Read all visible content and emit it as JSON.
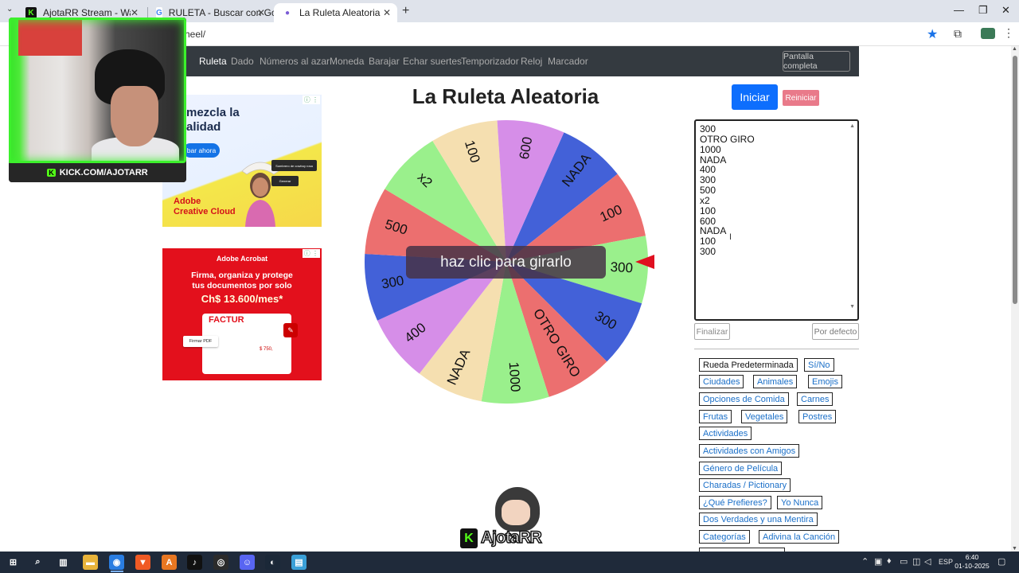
{
  "browser": {
    "tabs": [
      {
        "title": "AjotaRR Stream - Watch Live o",
        "fav": "K",
        "fav_color": "#111111",
        "fav_text": "#53fc18"
      },
      {
        "title": "RULETA - Buscar con Google",
        "fav": "G",
        "fav_color": "#ffffff",
        "fav_text": "#4285f4"
      },
      {
        "title": "La Ruleta Aleatoria",
        "fav": "●",
        "fav_color": "#ffffff",
        "fav_text": "#7b5cd6"
      }
    ],
    "url": "heel/",
    "newtab": "+",
    "controls": {
      "minimize": "—",
      "restore": "❐",
      "close": "✕"
    }
  },
  "nav": {
    "items": [
      "Ruleta",
      "Dado",
      "Números al azar",
      "Moneda",
      "Barajar",
      "Echar suertes",
      "Temporizador",
      "Reloj",
      "Marcador"
    ],
    "fullscreen": "Pantalla completa"
  },
  "page": {
    "title": "La Ruleta Aleatoria",
    "start": "Iniciar",
    "reset": "Reiniciar",
    "spin_prompt": "haz clic para girarlo",
    "finish": "Finalizar",
    "default": "Por defecto"
  },
  "entries": [
    "300",
    "OTRO GIRO",
    "1000",
    "NADA",
    "400",
    "300",
    "500",
    "x2",
    "100",
    "600",
    "NADA",
    "100",
    "300"
  ],
  "presets": [
    "Rueda Predeterminada",
    "Sí/No",
    "Ciudades",
    "Animales",
    "Emojis",
    "Opciones de Comida",
    "Carnes",
    "Frutas",
    "Vegetales",
    "Postres",
    "Actividades",
    "Actividades con Amigos",
    "Género de Película",
    "Charadas / Pictionary",
    "¿Qué Prefieres?",
    "Yo Nunca",
    "Dos Verdades y una Mentira",
    "Categorías",
    "Adivina la Canción"
  ],
  "wheel": {
    "segments": [
      {
        "label": "NADA",
        "color": "#4361d8"
      },
      {
        "label": "100",
        "color": "#ec6f6f"
      },
      {
        "label": "300",
        "color": "#9af08c"
      },
      {
        "label": "300",
        "color": "#4361d8"
      },
      {
        "label": "OTRO GIRO",
        "color": "#ec6f6f"
      },
      {
        "label": "1000",
        "color": "#9af08c"
      },
      {
        "label": "NADA",
        "color": "#f5dfb0"
      },
      {
        "label": "400",
        "color": "#d68ee8"
      },
      {
        "label": "300",
        "color": "#4361d8"
      },
      {
        "label": "500",
        "color": "#ec6f6f"
      },
      {
        "label": "x2",
        "color": "#9af08c"
      },
      {
        "label": "100",
        "color": "#f5dfb0"
      },
      {
        "label": "600",
        "color": "#d68ee8"
      }
    ],
    "pointer_color": "#e01020"
  },
  "ads": {
    "ad1": {
      "headline_1": "mezcla la",
      "headline_2": "alidad",
      "cta": "bar ahora",
      "brand_1": "Adobe",
      "brand_2": "Creative Cloud",
      "card_1": "Sombrero de cowboy rosa",
      "card_2": "Generar",
      "choice": "ⓘ ⋮"
    },
    "ad2": {
      "brand": "Adobe Acrobat",
      "line_1": "Firma, organiza y protege",
      "line_2": "tus documentos por solo",
      "price": "Ch$ 13.600/mes*",
      "doc_title": "FACTUR",
      "sign": "Firmar PDF",
      "amount": "$ 750,",
      "choice": "ⓘ ⋮"
    }
  },
  "webcam": {
    "kick_label": "KICK.COM/AJOTARR",
    "kick_badge": "K"
  },
  "streamer_logo": {
    "name": "AjotaRR",
    "badge": "K"
  },
  "taskbar": {
    "apps": [
      {
        "name": "windows",
        "color": "#1f2a3a",
        "glyph": "⊞"
      },
      {
        "name": "search",
        "color": "#1f2a3a",
        "glyph": "⌕"
      },
      {
        "name": "taskview",
        "color": "#1f2a3a",
        "glyph": "▥"
      },
      {
        "name": "explorer",
        "color": "#e8b33a",
        "glyph": "▬"
      },
      {
        "name": "chrome",
        "color": "#2a7de1",
        "glyph": "◉"
      },
      {
        "name": "brave",
        "color": "#f05a24",
        "glyph": "▼"
      },
      {
        "name": "app-a",
        "color": "#e87722",
        "glyph": "A"
      },
      {
        "name": "tiktok",
        "color": "#111111",
        "glyph": "♪"
      },
      {
        "name": "obs",
        "color": "#2b2b2b",
        "glyph": "◎"
      },
      {
        "name": "discord",
        "color": "#5865f2",
        "glyph": "☺"
      },
      {
        "name": "steam",
        "color": "#1b2838",
        "glyph": "◐"
      },
      {
        "name": "app-b",
        "color": "#3aa0d8",
        "glyph": "▤"
      }
    ],
    "lang": "ESP",
    "time": "6:40",
    "date": "01-10-2025"
  }
}
